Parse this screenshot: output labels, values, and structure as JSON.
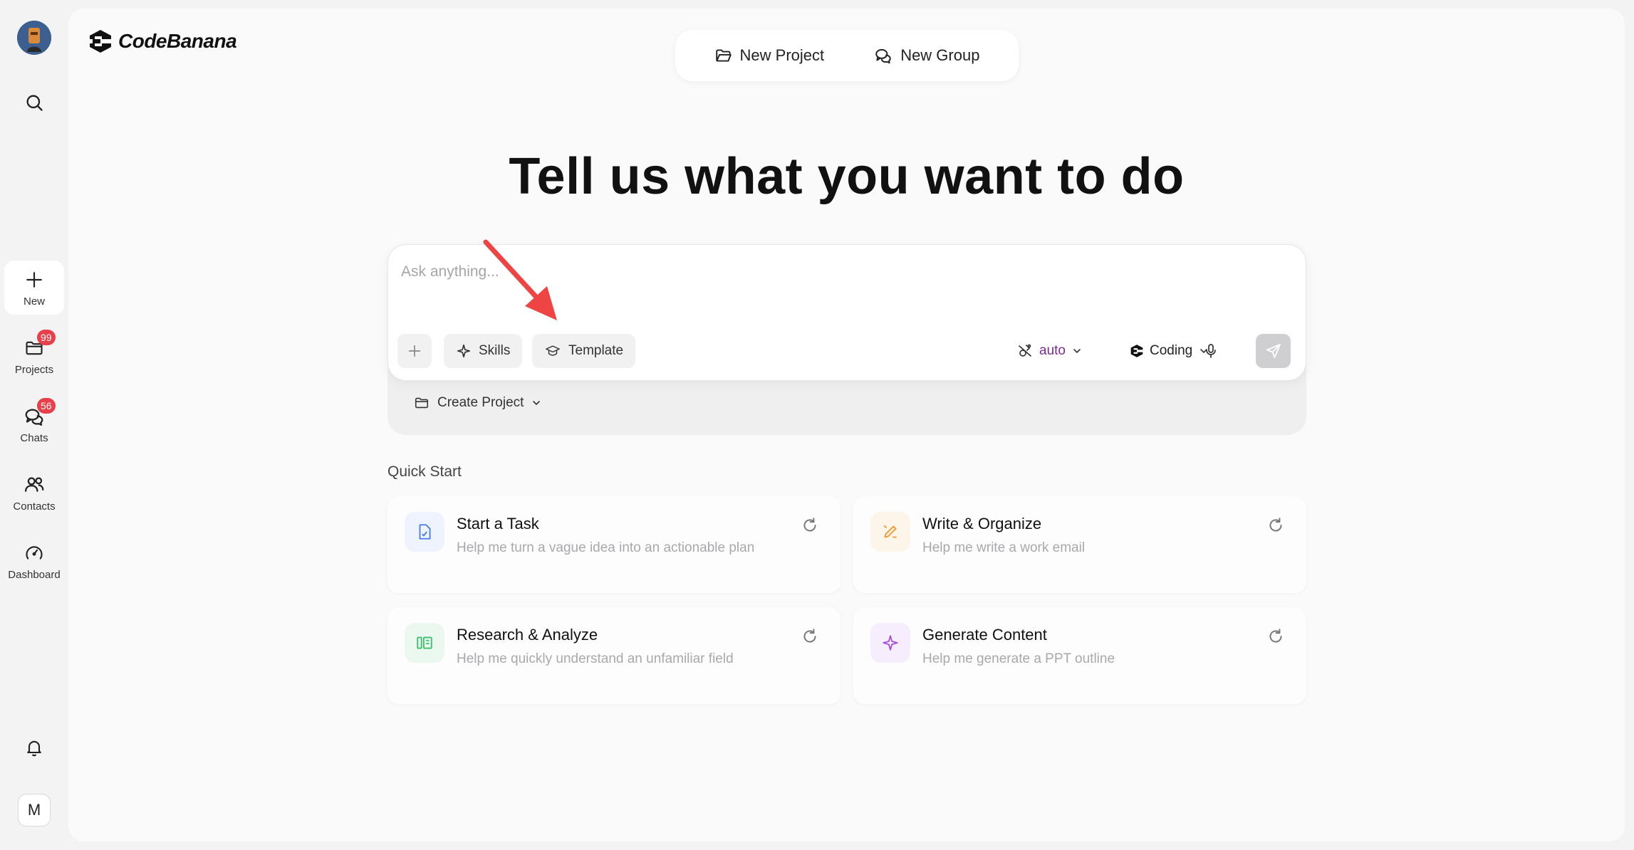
{
  "rail": {
    "new_label": "New",
    "projects_label": "Projects",
    "projects_badge": "99",
    "chats_label": "Chats",
    "chats_badge": "56",
    "contacts_label": "Contacts",
    "dashboard_label": "Dashboard",
    "user_initial": "M"
  },
  "header": {
    "brand": "CodeBanana",
    "new_project": "New Project",
    "new_group": "New Group"
  },
  "main": {
    "headline": "Tell us what you want to do",
    "prompt_placeholder": "Ask anything...",
    "skills_label": "Skills",
    "template_label": "Template",
    "model_value": "auto",
    "mode_value": "Coding",
    "create_project_label": "Create Project",
    "quick_start_title": "Quick Start"
  },
  "quick_start": [
    {
      "title": "Start a Task",
      "subtitle": "Help me turn a vague idea into an actionable plan",
      "icon": "document-icon",
      "color": "#4a7cf0",
      "bg": "#eef3fe"
    },
    {
      "title": "Write & Organize",
      "subtitle": "Help me write a work email",
      "icon": "pen-icon",
      "color": "#f29a2e",
      "bg": "#fef5ea"
    },
    {
      "title": "Research & Analyze",
      "subtitle": "Help me quickly understand an unfamiliar field",
      "icon": "columns-icon",
      "color": "#3fbf6e",
      "bg": "#ebf8ef"
    },
    {
      "title": "Generate Content",
      "subtitle": "Help me generate a PPT outline",
      "icon": "sparkle-icon",
      "color": "#a64fe0",
      "bg": "#f6eefd"
    }
  ],
  "colors": {
    "accent_model": "#7b2b8f",
    "badge": "#e8404a",
    "annotation_arrow": "#ef4444"
  }
}
